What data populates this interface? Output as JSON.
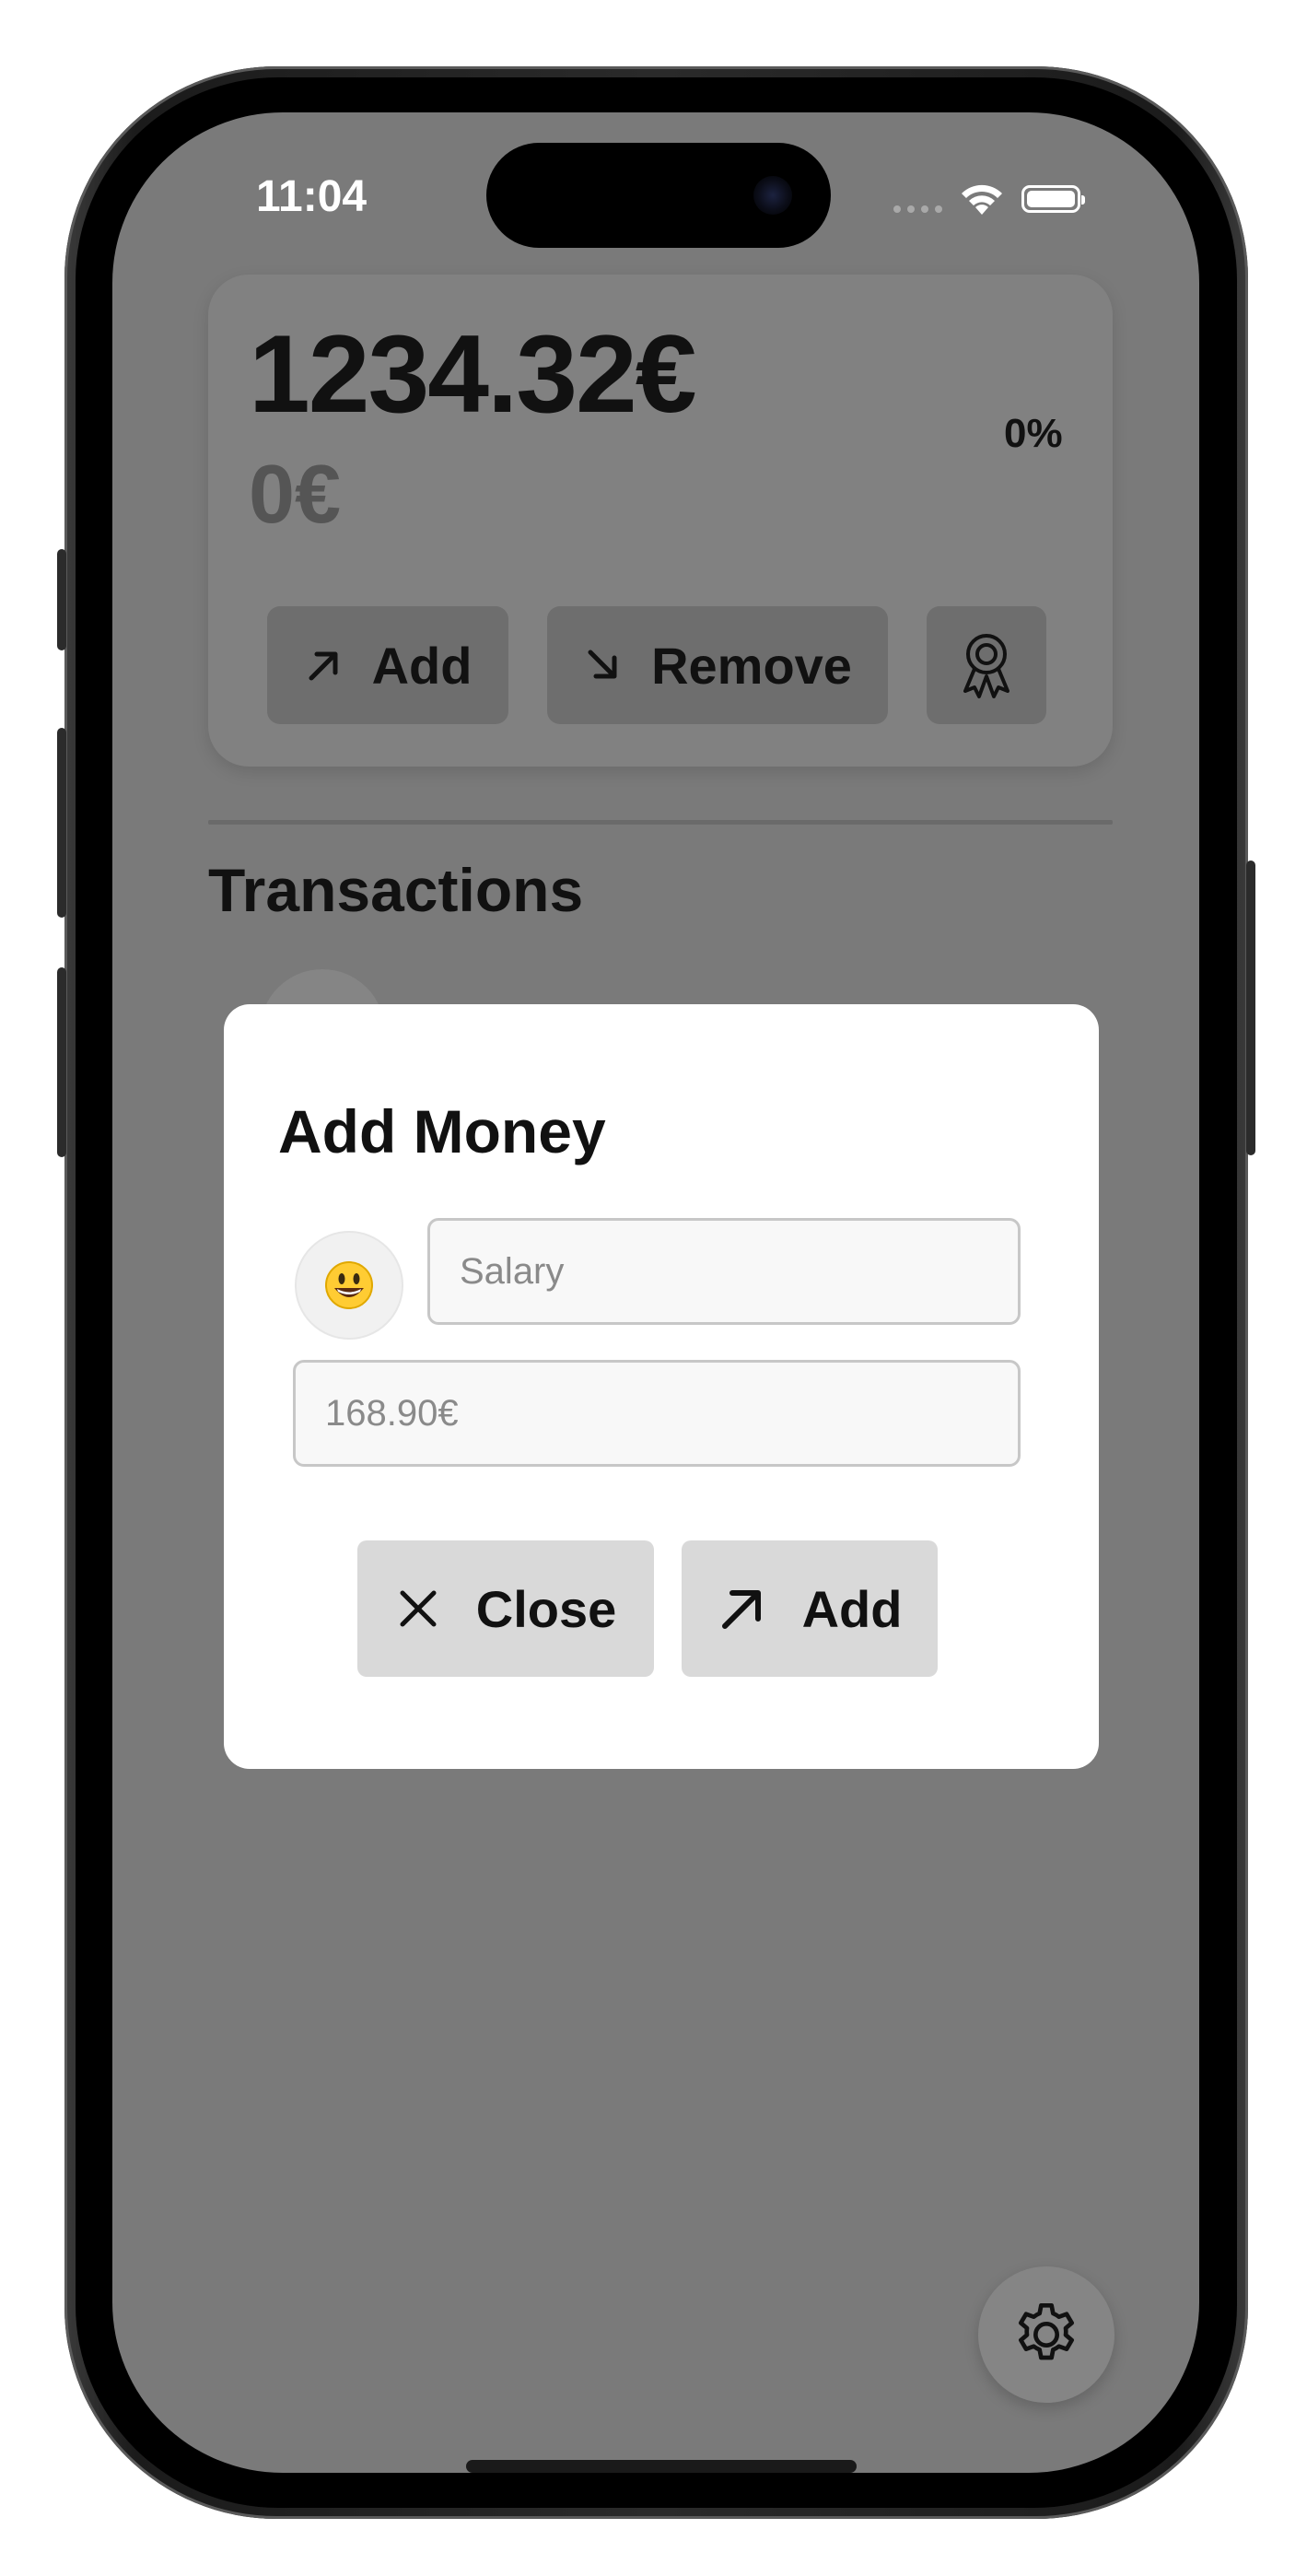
{
  "status_bar": {
    "time": "11:04"
  },
  "balance_card": {
    "balance": "1234.32€",
    "secondary_amount": "0€",
    "percent": "0%",
    "add_label": "Add",
    "remove_label": "Remove",
    "badge_icon": "award-icon"
  },
  "transactions": {
    "title": "Transactions"
  },
  "add_money_dialog": {
    "title": "Add Money",
    "emoji": "😃",
    "name_placeholder": "Salary",
    "amount_placeholder": "168.90€",
    "close_label": "Close",
    "add_label": "Add"
  },
  "settings": {
    "icon": "gear-icon"
  },
  "colors": {
    "overlay_background": "#7a7a7a",
    "dialog_background": "#ffffff",
    "button_background": "#d9d9d9",
    "text": "#111111"
  }
}
